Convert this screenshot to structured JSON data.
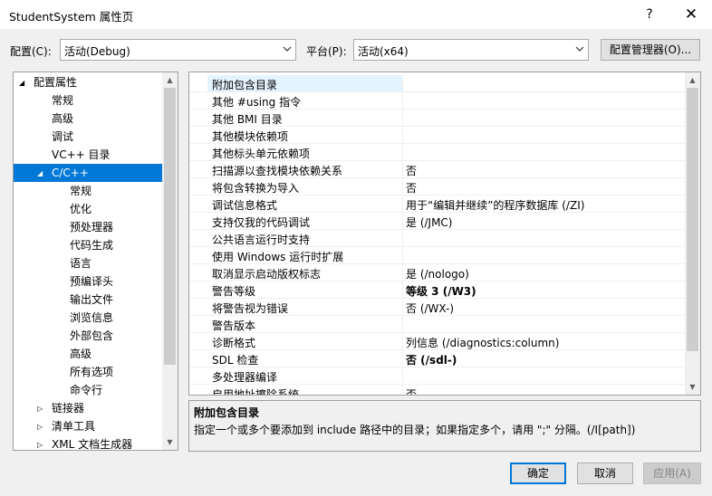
{
  "window": {
    "title": "StudentSystem 属性页",
    "help": "?",
    "close": "✕"
  },
  "toolbar": {
    "config_label": "配置(C):",
    "config_value": "活动(Debug)",
    "platform_label": "平台(P):",
    "platform_value": "活动(x64)",
    "config_manager": "配置管理器(O)..."
  },
  "tree": {
    "items": [
      {
        "label": "配置属性",
        "level": 0,
        "expander": "◢"
      },
      {
        "label": "常规",
        "level": 1
      },
      {
        "label": "高级",
        "level": 1
      },
      {
        "label": "调试",
        "level": 1
      },
      {
        "label": "VC++ 目录",
        "level": 1
      },
      {
        "label": "C/C++",
        "level": 1,
        "expander": "◢",
        "selected": true
      },
      {
        "label": "常规",
        "level": 2
      },
      {
        "label": "优化",
        "level": 2
      },
      {
        "label": "预处理器",
        "level": 2
      },
      {
        "label": "代码生成",
        "level": 2
      },
      {
        "label": "语言",
        "level": 2
      },
      {
        "label": "预编译头",
        "level": 2
      },
      {
        "label": "输出文件",
        "level": 2
      },
      {
        "label": "浏览信息",
        "level": 2
      },
      {
        "label": "外部包含",
        "level": 2
      },
      {
        "label": "高级",
        "level": 2
      },
      {
        "label": "所有选项",
        "level": 2
      },
      {
        "label": "命令行",
        "level": 2
      },
      {
        "label": "链接器",
        "level": 1,
        "expander": "▷"
      },
      {
        "label": "清单工具",
        "level": 1,
        "expander": "▷"
      },
      {
        "label": "XML 文档生成器",
        "level": 1,
        "expander": "▷"
      }
    ]
  },
  "grid": {
    "rows": [
      {
        "name": "附加包含目录",
        "value": ""
      },
      {
        "name": "其他 #using 指令",
        "value": ""
      },
      {
        "name": "其他 BMI 目录",
        "value": ""
      },
      {
        "name": "其他模块依赖项",
        "value": ""
      },
      {
        "name": "其他标头单元依赖项",
        "value": ""
      },
      {
        "name": "扫描源以查找模块依赖关系",
        "value": "否"
      },
      {
        "name": "将包含转换为导入",
        "value": "否"
      },
      {
        "name": "调试信息格式",
        "value": "用于“编辑并继续”的程序数据库 (/ZI)"
      },
      {
        "name": "支持仅我的代码调试",
        "value": "是 (/JMC)"
      },
      {
        "name": "公共语言运行时支持",
        "value": ""
      },
      {
        "name": "使用 Windows 运行时扩展",
        "value": ""
      },
      {
        "name": "取消显示启动版权标志",
        "value": "是 (/nologo)"
      },
      {
        "name": "警告等级",
        "value": "等级 3 (/W3)",
        "bold": true
      },
      {
        "name": "将警告视为错误",
        "value": "否 (/WX-)"
      },
      {
        "name": "警告版本",
        "value": ""
      },
      {
        "name": "诊断格式",
        "value": "列信息 (/diagnostics:column)"
      },
      {
        "name": "SDL 检查",
        "value": "否 (/sdl-)",
        "bold": true
      },
      {
        "name": "多处理器编译",
        "value": ""
      },
      {
        "name": "启用地址擦除系统",
        "value": "否"
      }
    ]
  },
  "description": {
    "title": "附加包含目录",
    "text": "指定一个或多个要添加到 include 路径中的目录；如果指定多个，请用 \";\" 分隔。(/I[path])"
  },
  "buttons": {
    "ok": "确定",
    "cancel": "取消",
    "apply": "应用(A)"
  }
}
